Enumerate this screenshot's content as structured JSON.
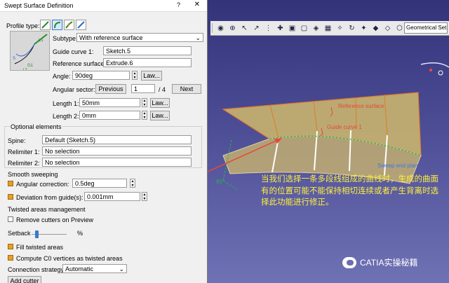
{
  "dialog": {
    "title": "Swept Surface Definition",
    "help": "?",
    "close": "✕",
    "profile_type_label": "Profile type:",
    "profile_types": [
      "line-sweep-icon",
      "circle-sweep-icon",
      "conic-sweep-icon",
      "explicit-sweep-icon"
    ],
    "preview_labels": [
      "L1",
      "G1",
      "S",
      "L2"
    ],
    "subtype_label": "Subtype:",
    "subtype_value": "With reference surface",
    "guide_curve_label": "Guide curve 1:",
    "guide_curve_value": "Sketch.5",
    "reference_surface_label": "Reference surface:",
    "reference_surface_value": "Extrude.6",
    "angle_label": "Angle:",
    "angle_value": "90deg",
    "law_label": "Law...",
    "angular_sector_label": "Angular sector:",
    "previous_label": "Previous",
    "sector_value": "1",
    "sector_total": "/ 4",
    "next_label": "Next",
    "length1_label": "Length 1:",
    "length1_value": "50mm",
    "length2_label": "Length 2:",
    "length2_value": "0mm",
    "optional_title": "Optional elements",
    "spine_label": "Spine:",
    "spine_value": "Default (Sketch.5)",
    "relimiter1_label": "Relimiter 1:",
    "relimiter1_value": "No selection",
    "relimiter2_label": "Relimiter 2:",
    "relimiter2_value": "No selection",
    "smooth_title": "Smooth sweeping",
    "angular_correction_label": "Angular correction:",
    "angular_correction_checked": true,
    "angular_correction_value": "0.5deg",
    "deviation_label": "Deviation from guide(s):",
    "deviation_checked": true,
    "deviation_value": "0.001mm",
    "twisted_title": "Twisted areas management",
    "remove_cutters_label": "Remove cutters on Preview",
    "remove_cutters_checked": false,
    "setback_label": "Setback",
    "setback_percent": "%",
    "setback_value": 0.1,
    "fill_twisted_label": "Fill twisted areas",
    "fill_twisted_checked": true,
    "compute_c0_label": "Compute C0 vertices as twisted areas",
    "compute_c0_checked": true,
    "connection_label": "Connection strategy:",
    "connection_value": "Automatic",
    "add_cutter_label": "Add cutter"
  },
  "toolbar": {
    "icons": [
      "toggle-icon",
      "axis-icon",
      "select-icon",
      "vector-icon",
      "dotted-frame-icon",
      "snap-icon",
      "cube-icon",
      "frame-icon",
      "isometric-icon",
      "grid-icon",
      "compass-icon",
      "repeat-icon",
      "light-icon",
      "magnet-icon",
      "plane-icon",
      "view-icon"
    ],
    "view_select": "Geometrical Set"
  },
  "scene": {
    "reference_surface_label": "Reference surface",
    "guide_curve_label": "Guide curve 1",
    "sweep_end_label": "Sweep end plan",
    "annotation": "当我们选择一条多段线组成的曲线时，生成的曲面有的位置可能不能保持相切连续或者产生背离时选择此功能进行修正。",
    "watermark": "CATIA实操秘籍",
    "colors": {
      "surface": "#c9b46e",
      "surface_edge": "#e07a2a",
      "arrow": "#e8473a",
      "annotation": "#ffef3a",
      "guide": "#2db34a"
    }
  }
}
